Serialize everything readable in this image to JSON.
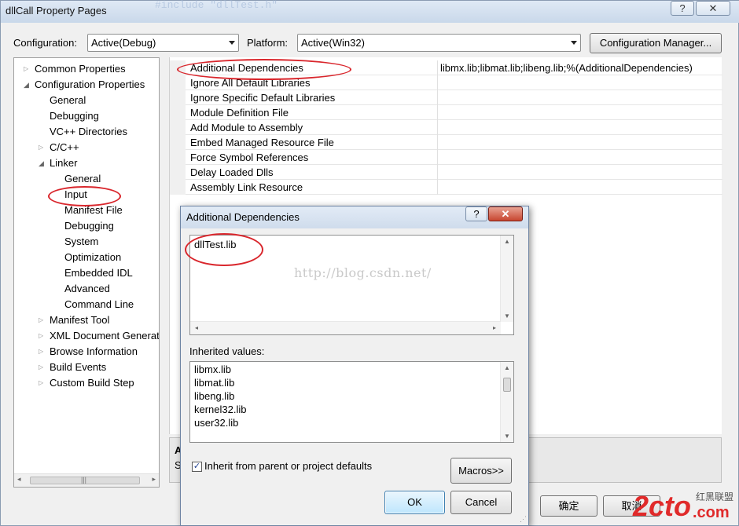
{
  "window": {
    "title": "dllCall Property Pages",
    "help_glyph": "?",
    "close_glyph": "✕",
    "background_code": "#include \"dllTest.h\""
  },
  "toolbar": {
    "configuration_label": "Configuration:",
    "configuration_value": "Active(Debug)",
    "platform_label": "Platform:",
    "platform_value": "Active(Win32)",
    "config_manager_label": "Configuration Manager..."
  },
  "tree": {
    "items": [
      {
        "label": "Common Properties",
        "twisty": "▷"
      },
      {
        "label": "Configuration Properties",
        "twisty": "◢"
      },
      {
        "label": "General",
        "twisty": ""
      },
      {
        "label": "Debugging",
        "twisty": ""
      },
      {
        "label": "VC++ Directories",
        "twisty": ""
      },
      {
        "label": "C/C++",
        "twisty": "▷"
      },
      {
        "label": "Linker",
        "twisty": "◢"
      },
      {
        "label": "General",
        "twisty": ""
      },
      {
        "label": "Input",
        "twisty": ""
      },
      {
        "label": "Manifest File",
        "twisty": ""
      },
      {
        "label": "Debugging",
        "twisty": ""
      },
      {
        "label": "System",
        "twisty": ""
      },
      {
        "label": "Optimization",
        "twisty": ""
      },
      {
        "label": "Embedded IDL",
        "twisty": ""
      },
      {
        "label": "Advanced",
        "twisty": ""
      },
      {
        "label": "Command Line",
        "twisty": ""
      },
      {
        "label": "Manifest Tool",
        "twisty": "▷"
      },
      {
        "label": "XML Document Generat",
        "twisty": "▷"
      },
      {
        "label": "Browse Information",
        "twisty": "▷"
      },
      {
        "label": "Build Events",
        "twisty": "▷"
      },
      {
        "label": "Custom Build Step",
        "twisty": "▷"
      }
    ],
    "scroll_grip": "|||",
    "scroll_left": "◂",
    "scroll_right": "▸"
  },
  "grid": {
    "rows": [
      {
        "name": "Additional Dependencies",
        "value": "libmx.lib;libmat.lib;libeng.lib;%(AdditionalDependencies)"
      },
      {
        "name": "Ignore All Default Libraries",
        "value": ""
      },
      {
        "name": "Ignore Specific Default Libraries",
        "value": ""
      },
      {
        "name": "Module Definition File",
        "value": ""
      },
      {
        "name": "Add Module to Assembly",
        "value": ""
      },
      {
        "name": "Embed Managed Resource File",
        "value": ""
      },
      {
        "name": "Force Symbol References",
        "value": ""
      },
      {
        "name": "Delay Loaded Dlls",
        "value": ""
      },
      {
        "name": "Assembly Link Resource",
        "value": ""
      }
    ],
    "description_title": "A",
    "description_text": "S"
  },
  "footer": {
    "ok_label": "确定",
    "cancel_label": "取消"
  },
  "dialog": {
    "title": "Additional Dependencies",
    "help_glyph": "?",
    "close_glyph": "✕",
    "edit_text": "dllTest.lib",
    "watermark": "http://blog.csdn.net/",
    "inherited_label": "Inherited values:",
    "inherited_values": [
      "libmx.lib",
      "libmat.lib",
      "libeng.lib",
      "kernel32.lib",
      "user32.lib"
    ],
    "inherit_checkbox_checked": true,
    "checkmark": "✓",
    "inherit_checkbox_label": "Inherit from parent or project defaults",
    "macros_label": "Macros>>",
    "ok_label": "OK",
    "cancel_label": "Cancel",
    "scroll_up": "▲",
    "scroll_down": "▼",
    "scroll_left": "◂",
    "scroll_right": "▸",
    "grip": "⋰"
  },
  "logo": {
    "text": "2cto",
    "domain": ".com",
    "tagline": "红黑联盟"
  },
  "colors": {
    "annotation_red": "#d9262c",
    "logo_red": "#e02a2a",
    "ok_button_blue": "#3c7fb1"
  }
}
